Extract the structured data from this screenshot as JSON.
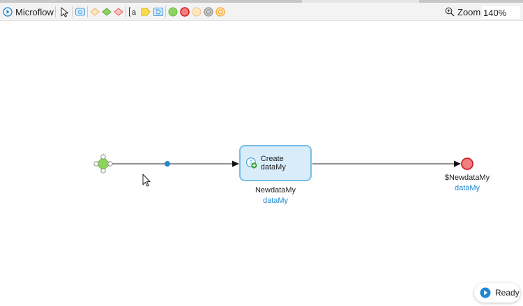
{
  "editor": {
    "title": "Microflow"
  },
  "toolbar": {
    "tools": [
      "pointer-icon",
      "activity-icon",
      "split-icon",
      "merge-icon",
      "inheritance-split-icon",
      "annotation-icon",
      "parameter-icon",
      "loop-icon",
      "start-event-icon",
      "end-event-icon",
      "error-event-icon",
      "break-event-icon",
      "continue-event-icon"
    ],
    "annotation_glyph": "a"
  },
  "zoom": {
    "label": "Zoom",
    "value": "140%"
  },
  "flow": {
    "activity": {
      "label": "Create dataMy",
      "caption": "NewdataMy",
      "subcaption": "dataMy"
    },
    "end_event": {
      "caption": "$NewdataMy",
      "subcaption": "dataMy"
    }
  },
  "status": {
    "label": "Ready"
  },
  "colors": {
    "start": "#8dd35f",
    "end": "#f08080",
    "activity_fill": "#d9ecfa",
    "activity_border": "#79bde9",
    "link": "#1e88d1"
  }
}
